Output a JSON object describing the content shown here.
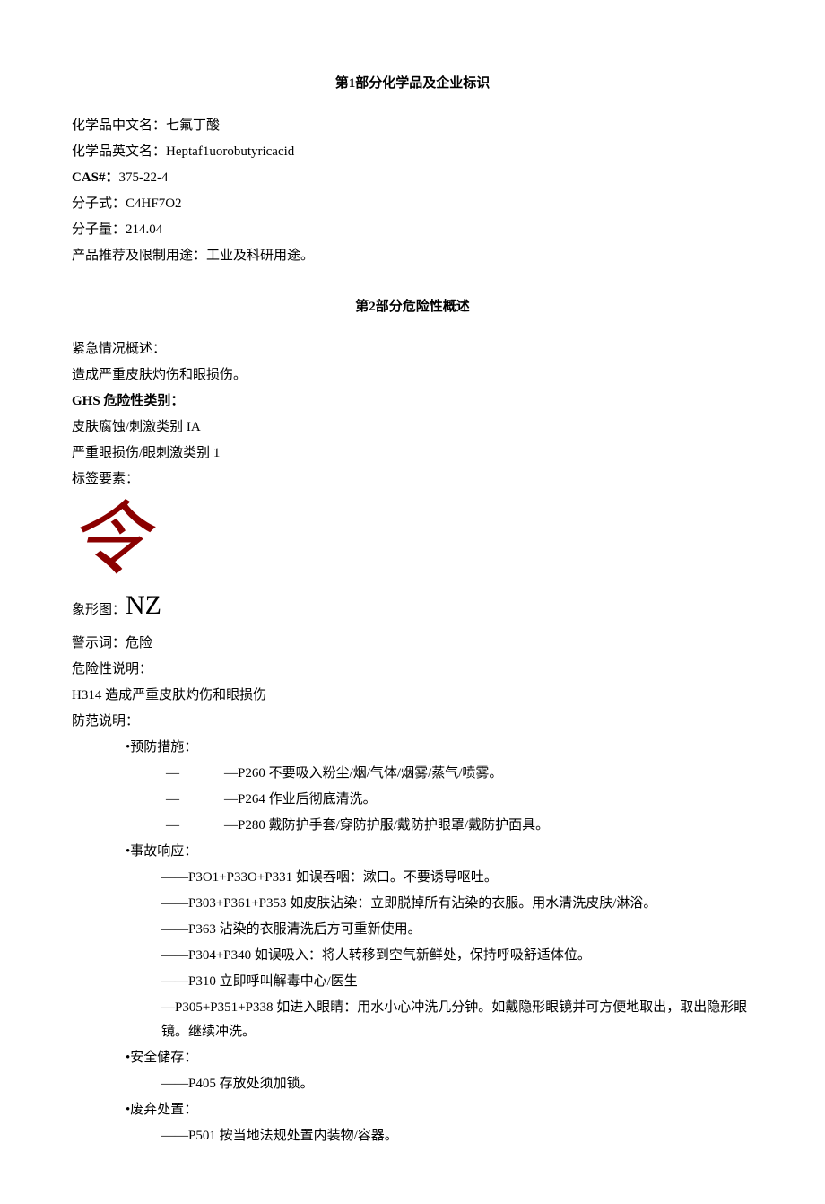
{
  "section1": {
    "title_prefix": "第",
    "title_num": "1",
    "title_suffix": "部分化学品及企业标识",
    "cn_name_label": "化学品中文名：",
    "cn_name_value": "七氟丁酸",
    "en_name_label": "化学品英文名：",
    "en_name_value": "Heptaf1uorobutyricacid",
    "cas_label": "CAS#：",
    "cas_value": "375-22-4",
    "formula_label": "分子式：",
    "formula_value": "C4HF7O2",
    "weight_label": "分子量：",
    "weight_value": "214.04",
    "use_label": "产品推荐及限制用途：",
    "use_value": "工业及科研用途。"
  },
  "section2": {
    "title_prefix": "第",
    "title_num": "2",
    "title_suffix": "部分危险性概述",
    "emergency_label": "紧急情况概述：",
    "emergency_value": "造成严重皮肤灼伤和眼损伤。",
    "ghs_label": "GHS 危险性类别：",
    "ghs_line1": "皮肤腐蚀/刺激类别 IA",
    "ghs_line2": "严重眼损伤/眼刺激类别 1",
    "label_elements": "标签要素：",
    "pictogram_char": "令",
    "pictogram_label": "象形图：",
    "pictogram_value": "NZ",
    "signal_label": "警示词：",
    "signal_value": "危险",
    "hazard_label": "危险性说明：",
    "hazard_value": "H314 造成严重皮肤灼伤和眼损伤",
    "precaution_label": "防范说明：",
    "prevention_header": "•预防措施：",
    "prevention_items": [
      "—P260 不要吸入粉尘/烟/气体/烟雾/蒸气/喷雾。",
      "—P264 作业后彻底清洗。",
      "—P280 戴防护手套/穿防护服/戴防护眼罩/戴防护面具。"
    ],
    "response_header": "•事故响应：",
    "response_items": [
      "——P3O1+P33O+P331 如误吞咽：漱口。不要诱导呕吐。",
      "——P303+P361+P353 如皮肤沾染：立即脱掉所有沾染的衣服。用水清洗皮肤/淋浴。",
      "——P363 沾染的衣服清洗后方可重新使用。",
      "——P304+P340 如误吸入：将人转移到空气新鲜处，保持呼吸舒适体位。",
      "——P310 立即呼叫解毒中心/医生"
    ],
    "response_eye": "—P305+P351+P338 如进入眼睛：用水小心冲洗几分钟。如戴隐形眼镜并可方便地取出，取出隐形眼镜。继续冲洗。",
    "storage_header": "•安全储存：",
    "storage_item": "——P405 存放处须加锁。",
    "disposal_header": "•废弃处置：",
    "disposal_item": "——P501 按当地法规处置内装物/容器。"
  }
}
